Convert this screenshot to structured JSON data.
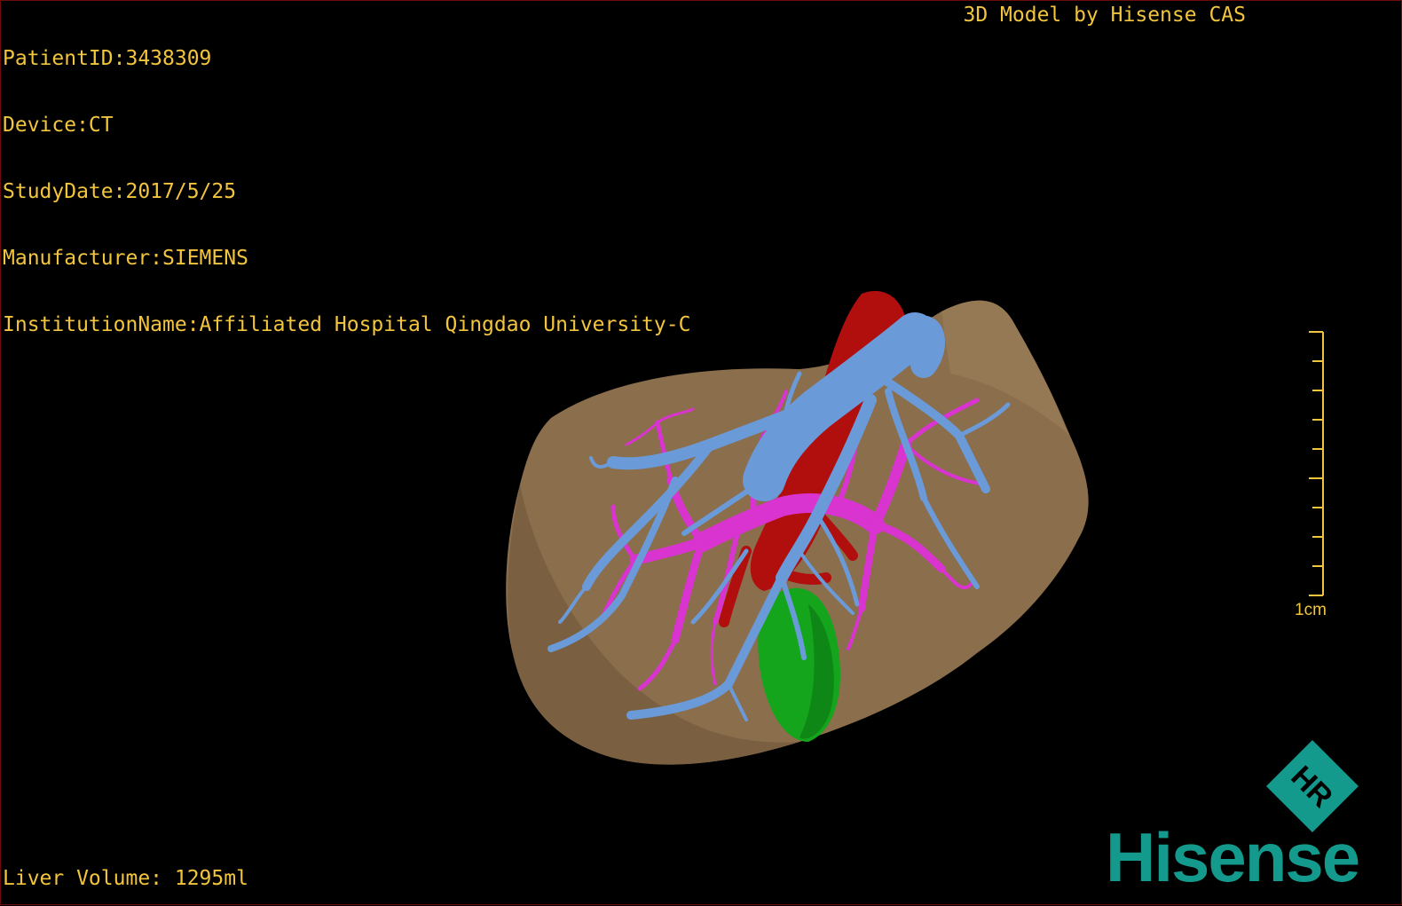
{
  "header": {
    "info_lines": [
      "PatientID:3438309",
      "Device:CT",
      "StudyDate:2017/5/25",
      "Manufacturer:SIEMENS",
      "InstitutionName:Affiliated Hospital Qingdao University-C"
    ],
    "brand_title": "3D Model by Hisense CAS"
  },
  "footer": {
    "volume_text": "Liver Volume: 1295ml"
  },
  "scale_bar": {
    "label": "1cm"
  },
  "logo": {
    "text": "Hisense",
    "mark_letters": "HR"
  },
  "colors": {
    "overlay_text": "#f2c53d",
    "liver": "#8b6e4c",
    "hepatic_vein": "#6b9ad8",
    "portal_vein": "#d933d0",
    "artery": "#b10e0e",
    "gallbladder": "#14a51d",
    "brand": "#149a8c"
  },
  "scene": {
    "structures": [
      "liver",
      "hepatic-vein",
      "portal-vein",
      "artery",
      "gallbladder"
    ]
  }
}
